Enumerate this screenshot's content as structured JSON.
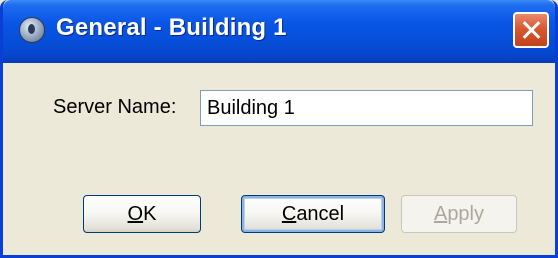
{
  "window": {
    "title": "General - Building 1"
  },
  "form": {
    "server_name_label": "Server Name:",
    "server_name_value": "Building 1"
  },
  "buttons": {
    "ok": {
      "accel": "O",
      "rest": "K"
    },
    "cancel": {
      "accel": "C",
      "rest": "ancel"
    },
    "apply": {
      "accel": "A",
      "rest": "pply",
      "enabled": false
    }
  },
  "colors": {
    "titlebar": "#0650db",
    "close_button": "#d8582f",
    "window_face": "#ece9d8",
    "disabled_text": "#aca899"
  },
  "icons": {
    "app": "server-properties-icon",
    "close": "close-icon"
  }
}
